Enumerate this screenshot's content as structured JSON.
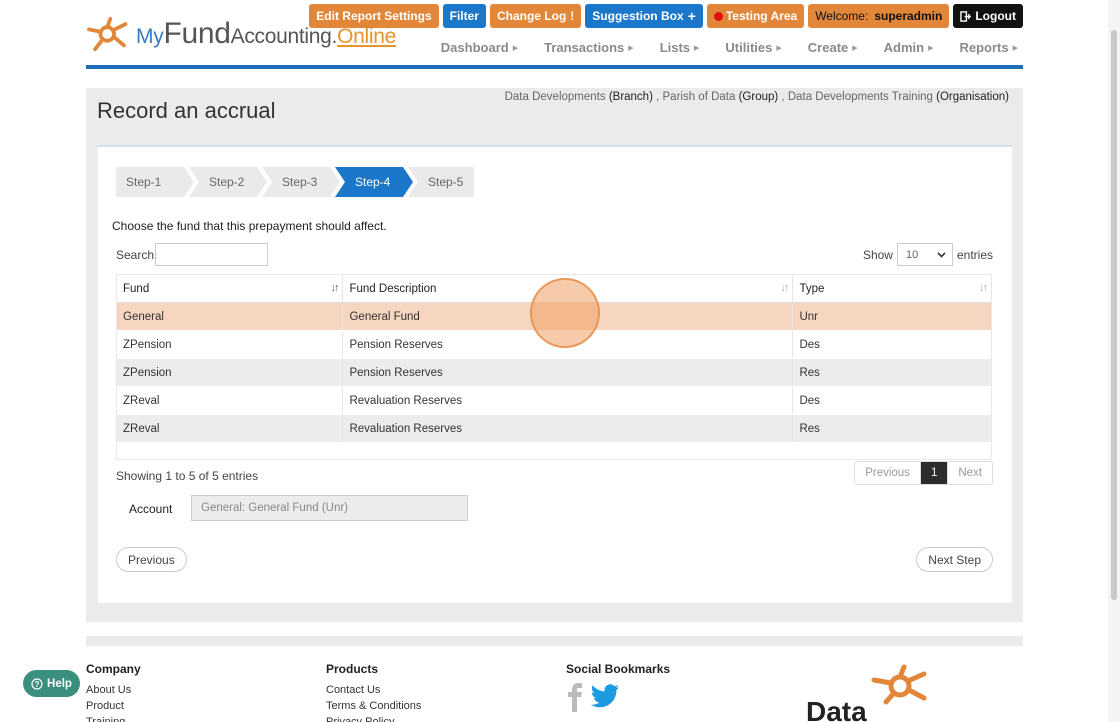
{
  "brand": {
    "my": "My",
    "fund": "Fund",
    "accounting": "Accounting",
    "dot": ".",
    "online": "Online"
  },
  "topbar": {
    "edit_report": "Edit Report Settings",
    "filter": "Filter",
    "change_log": "Change Log",
    "change_log_mark": "!",
    "suggestion": "Suggestion Box",
    "suggestion_mark": "+",
    "testing": "Testing Area",
    "welcome": "Welcome:",
    "user": "superadmin",
    "logout": "Logout"
  },
  "nav": [
    {
      "label": "Dashboard"
    },
    {
      "label": "Transactions"
    },
    {
      "label": "Lists"
    },
    {
      "label": "Utilities"
    },
    {
      "label": "Create"
    },
    {
      "label": "Admin"
    },
    {
      "label": "Reports"
    }
  ],
  "page": {
    "title": "Record an accrual",
    "org": {
      "branch_name": "Data Developments",
      "branch_type": "(Branch)",
      "group_name": "Parish of Data",
      "group_type": "(Group)",
      "org_name": "Data Developments Training",
      "org_type": "(Organisation)"
    }
  },
  "steps": [
    {
      "label": "Step-1",
      "active": false
    },
    {
      "label": "Step-2",
      "active": false
    },
    {
      "label": "Step-3",
      "active": false
    },
    {
      "label": "Step-4",
      "active": true
    },
    {
      "label": "Step-5",
      "active": false
    }
  ],
  "instruction": "Choose the fund that this prepayment should affect.",
  "search": {
    "label": "Search:",
    "value": ""
  },
  "show": {
    "prefix": "Show",
    "value": "10",
    "suffix": "entries"
  },
  "table": {
    "headers": [
      "Fund",
      "Fund Description",
      "Type"
    ],
    "rows": [
      {
        "fund": "General",
        "desc": "General Fund",
        "type": "Unr",
        "selected": true
      },
      {
        "fund": "ZPension",
        "desc": "Pension Reserves",
        "type": "Des"
      },
      {
        "fund": "ZPension",
        "desc": "Pension Reserves",
        "type": "Res"
      },
      {
        "fund": "ZReval",
        "desc": "Revaluation Reserves",
        "type": "Des"
      },
      {
        "fund": "ZReval",
        "desc": "Revaluation Reserves",
        "type": "Res"
      }
    ]
  },
  "showing": "Showing 1 to 5 of 5 entries",
  "pager": {
    "prev": "Previous",
    "current": "1",
    "next": "Next"
  },
  "account": {
    "label": "Account",
    "value": "General: General Fund (Unr)"
  },
  "buttons": {
    "previous": "Previous",
    "next_step": "Next Step"
  },
  "footer": {
    "company": {
      "heading": "Company",
      "links": [
        "About Us",
        "Product",
        "Training"
      ]
    },
    "products": {
      "heading": "Products",
      "links": [
        "Contact Us",
        "Terms & Conditions",
        "Privacy Policy"
      ]
    },
    "social": {
      "heading": "Social Bookmarks"
    },
    "data_logo": "Data"
  },
  "help": "Help",
  "colors": {
    "accent_blue": "#1a77c9",
    "accent_orange": "#e2873a",
    "selected_row": "#f6d6c0"
  }
}
